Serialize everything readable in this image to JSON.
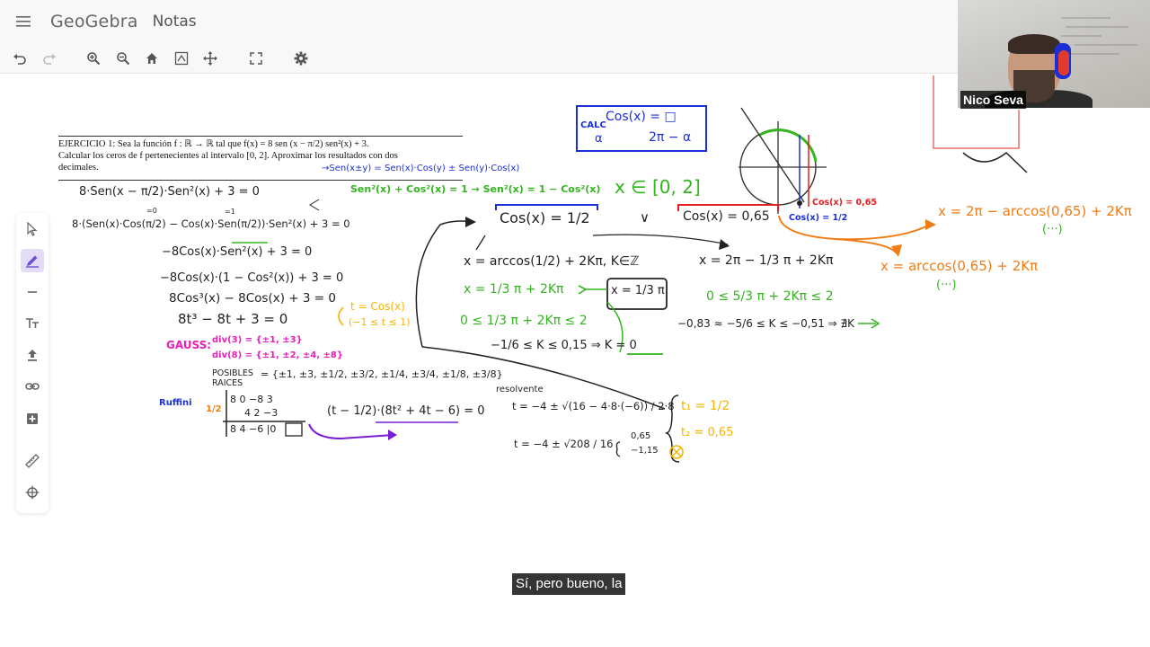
{
  "header": {
    "logo": "GeoGebra",
    "app_name": "Notas"
  },
  "toolbar": {
    "icons": [
      "undo-icon",
      "redo-icon",
      "zoom-in-icon",
      "zoom-out-icon",
      "home-icon",
      "standard-view-icon",
      "move-view-icon",
      "fullscreen-icon",
      "settings-icon"
    ]
  },
  "palette": {
    "icons": [
      "pointer-icon",
      "pen-icon",
      "line-icon",
      "text-icon",
      "upload-icon",
      "link-icon",
      "add-icon",
      "ruler-icon",
      "target-icon"
    ]
  },
  "exercise": {
    "line1": "EJERCICIO 1: Sea la función f : ℝ → ℝ tal que f(x) = 8 sen (x − π/2) sen²(x) + 3.",
    "line2": "Calcular los ceros de f pertenecientes al intervalo [0, 2]. Aproximar los resultados con dos",
    "line3": "decimales."
  },
  "notes": {
    "identity_sum": "→Sen(x±y) = Sen(x)·Cos(y) ± Sen(y)·Cos(x)",
    "pythag": "Sen²(x) + Cos²(x) = 1 → Sen²(x) = 1 − Cos²(x)",
    "calc_box_l1": "Cos(x) = □",
    "calc_box_label": "CALC",
    "calc_box_alpha": "α",
    "calc_box_l2": "2π − α",
    "domain": "x ∈ [0, 2]",
    "or_symbol": "∨",
    "eq1": "8·Sen(x − π/2)·Sen²(x) + 3 = 0",
    "eq2_label": "8·(Sen(x)·Cos(π/2) − Cos(x)·Sen(π/2))·Sen²(x) + 3 = 0",
    "eq2_top0": "=0",
    "eq2_top1": "=1",
    "eq3": "−8Cos(x)·Sen²(x) + 3 = 0",
    "eq4": "−8Cos(x)·(1 − Cos²(x)) + 3 = 0",
    "eq5": "8Cos³(x) − 8Cos(x) + 3 = 0",
    "eq6": "8t³  −  8t + 3 = 0",
    "subst": "t = Cos(x)",
    "subst_range": "(−1 ≤ t ≤ 1)",
    "gauss_label": "GAUSS:",
    "gauss_div3": "div(3) = {±1, ±3}",
    "gauss_div8": "div(8) = {±1, ±2, ±4, ±8}",
    "possible_roots_label": "POSIBLES RAICES",
    "possible_roots": "= {±1, ±3, ±1/2, ±3/2, ±1/4, ±3/4, ±1/8, ±3/8}",
    "ruffini_label": "Ruffini",
    "ruffini_half": "1/2",
    "ruffini_row1": "8   0   −8   3",
    "ruffini_row2": "4    2   −3",
    "ruffini_row3": "8   4   −6  |0",
    "factored": "(t − 1/2)·(8t² + 4t − 6) = 0",
    "resolvente_label": "resolvente",
    "resolvente1": "t = −4 ± √(16 − 4·8·(−6)) / 2·8",
    "resolvente2": "t = −4 ± √208 / 16",
    "resolvente_roots_top": "0,65",
    "resolvente_roots_bottom": "−1,15",
    "t1": "t₁ = 1/2",
    "t2": "t₂ = 0,65",
    "cos_half": "Cos(x) = 1/2",
    "cos_065": "Cos(x) = 0,65",
    "cos065_small": "Cos(x) = 0,65",
    "cos_half_small": "Cos(x) = 1/2",
    "x_arccos_half": "x = arccos(1/2) + 2Kπ, K∈ℤ",
    "x_third_pi": "x = 1/3 π + 2Kπ",
    "x_third_box": "x = 1/3 π",
    "ineq1": "0 ≤ 1/3 π + 2Kπ ≤ 2",
    "ineq2": "−1/6 ≤ K ≤ 0,15 ⇒ K = 0",
    "x_2pi": "x = 2π − 1/3 π + 2Kπ",
    "ineq3": "0 ≤ 5/3 π + 2Kπ ≤ 2",
    "ineq4": "−0,83 ≈ −5/6 ≤ K ≤ −0,51 ⇒ ∄K",
    "x_2pi_arccos": "x = 2π − arccos(0,65) + 2Kπ",
    "x_arccos_065": "x = arccos(0,65) + 2Kπ",
    "dots": "(···)"
  },
  "webcam": {
    "name": "Nico Seva"
  },
  "caption": "Sí, pero bueno, la",
  "colors": {
    "green": "#33b51f",
    "blue": "#1b2fd8",
    "cyan": "#14c4e6",
    "magenta": "#e81fb8",
    "orange": "#f07c16",
    "red": "#e32020",
    "purple": "#7a1ed6",
    "yellow": "#f5b400",
    "black": "#222222"
  }
}
